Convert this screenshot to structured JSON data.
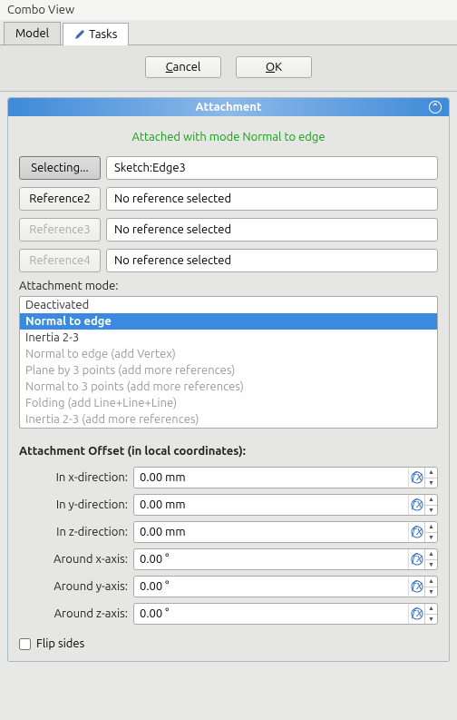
{
  "window": {
    "title": "Combo View"
  },
  "tabs": [
    {
      "label": "Model",
      "active": false
    },
    {
      "label": "Tasks",
      "active": true
    }
  ],
  "actions": {
    "cancel": "Cancel",
    "ok": "OK"
  },
  "panel": {
    "title": "Attachment",
    "status": "Attached with mode Normal to edge",
    "references": [
      {
        "button_label": "Selecting...",
        "field": "Sketch:Edge3",
        "state": "selecting"
      },
      {
        "button_label": "Reference2",
        "field": "No reference selected",
        "state": "normal"
      },
      {
        "button_label": "Reference3",
        "field": "No reference selected",
        "state": "disabled"
      },
      {
        "button_label": "Reference4",
        "field": "No reference selected",
        "state": "disabled"
      }
    ],
    "mode_label": "Attachment mode:",
    "modes": [
      {
        "label": "Deactivated",
        "state": "normal"
      },
      {
        "label": "Normal to edge",
        "state": "selected"
      },
      {
        "label": "Inertia 2-3",
        "state": "normal"
      },
      {
        "label": "Normal to edge (add Vertex)",
        "state": "disabled"
      },
      {
        "label": "Plane by 3 points (add more references)",
        "state": "disabled"
      },
      {
        "label": "Normal to 3 points (add more references)",
        "state": "disabled"
      },
      {
        "label": "Folding (add Line+Line+Line)",
        "state": "disabled"
      },
      {
        "label": "Inertia 2-3 (add more references)",
        "state": "disabled"
      }
    ],
    "offset_header": "Attachment Offset (in local coordinates):",
    "offsets": [
      {
        "label": "In x-direction:",
        "value": "0.00 mm"
      },
      {
        "label": "In y-direction:",
        "value": "0.00 mm"
      },
      {
        "label": "In z-direction:",
        "value": "0.00 mm"
      },
      {
        "label": "Around x-axis:",
        "value": "0.00 °"
      },
      {
        "label": "Around y-axis:",
        "value": "0.00 °"
      },
      {
        "label": "Around z-axis:",
        "value": "0.00 °"
      }
    ],
    "flip_label": "Flip sides",
    "flip_checked": false
  }
}
